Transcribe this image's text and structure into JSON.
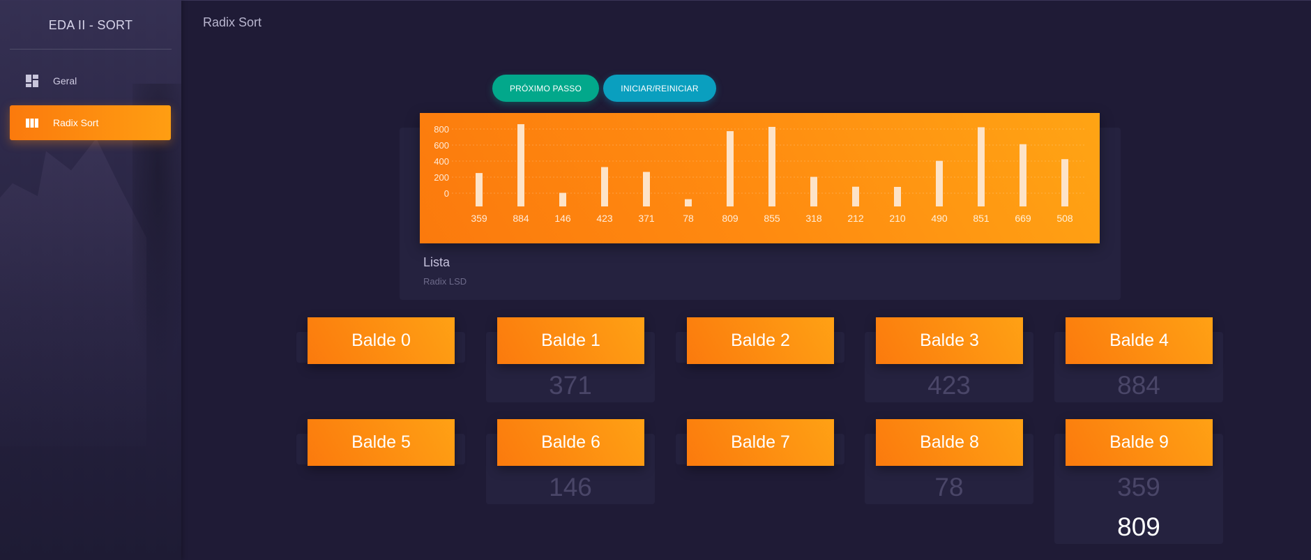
{
  "sidebar": {
    "brand": "EDA II - SORT",
    "items": [
      {
        "label": "Geral",
        "icon": "dashboard-icon"
      },
      {
        "label": "Radix Sort",
        "icon": "bars-icon"
      }
    ]
  },
  "topbar": {
    "title": "Radix Sort"
  },
  "buttons": {
    "next": "PRÓXIMO PASSO",
    "start": "INICIAR/REINICIAR"
  },
  "card": {
    "title": "Lista",
    "subtitle": "Radix LSD"
  },
  "chart_data": {
    "type": "bar",
    "categories": [
      "359",
      "884",
      "146",
      "423",
      "371",
      "78",
      "809",
      "855",
      "318",
      "212",
      "210",
      "490",
      "851",
      "669",
      "508"
    ],
    "values": [
      359,
      884,
      146,
      423,
      371,
      78,
      809,
      855,
      318,
      212,
      210,
      490,
      851,
      669,
      508
    ],
    "yticks": [
      "800",
      "600",
      "400",
      "200",
      "0"
    ],
    "ylim": [
      0,
      900
    ],
    "grid": true,
    "bar_color": "#fde3c8"
  },
  "buckets": [
    {
      "label": "Balde 0",
      "values": []
    },
    {
      "label": "Balde 1",
      "values": [
        "371"
      ]
    },
    {
      "label": "Balde 2",
      "values": []
    },
    {
      "label": "Balde 3",
      "values": [
        "423"
      ]
    },
    {
      "label": "Balde 4",
      "values": [
        "884"
      ]
    },
    {
      "label": "Balde 5",
      "values": []
    },
    {
      "label": "Balde 6",
      "values": [
        "146"
      ]
    },
    {
      "label": "Balde 7",
      "values": []
    },
    {
      "label": "Balde 8",
      "values": [
        "78"
      ]
    },
    {
      "label": "Balde 9",
      "values": [
        "359",
        "809"
      ]
    }
  ],
  "colors": {
    "accent": "#fb8a10",
    "teal": "#02a88b",
    "cyan": "#0a9fbf",
    "background": "#1f1b36"
  }
}
